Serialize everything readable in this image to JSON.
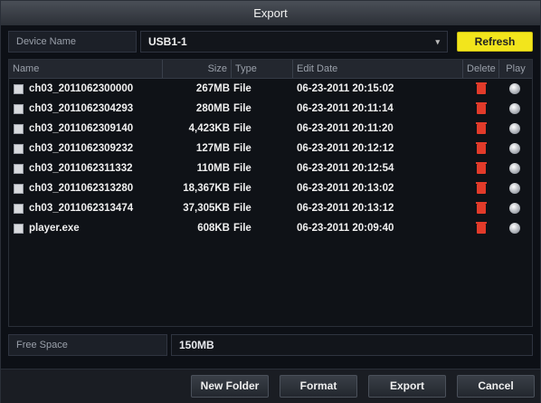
{
  "window": {
    "title": "Export"
  },
  "device": {
    "label": "Device Name",
    "selected": "USB1-1",
    "refresh_label": "Refresh"
  },
  "table": {
    "headers": {
      "name": "Name",
      "size": "Size",
      "type": "Type",
      "date": "Edit Date",
      "delete": "Delete",
      "play": "Play"
    },
    "rows": [
      {
        "name": "ch03_2011062300000",
        "size": "267MB",
        "type": "File",
        "date": "06-23-2011 20:15:02"
      },
      {
        "name": "ch03_2011062304293",
        "size": "280MB",
        "type": "File",
        "date": "06-23-2011 20:11:14"
      },
      {
        "name": "ch03_2011062309140",
        "size": "4,423KB",
        "type": "File",
        "date": "06-23-2011 20:11:20"
      },
      {
        "name": "ch03_2011062309232",
        "size": "127MB",
        "type": "File",
        "date": "06-23-2011 20:12:12"
      },
      {
        "name": "ch03_2011062311332",
        "size": "110MB",
        "type": "File",
        "date": "06-23-2011 20:12:54"
      },
      {
        "name": "ch03_2011062313280",
        "size": "18,367KB",
        "type": "File",
        "date": "06-23-2011 20:13:02"
      },
      {
        "name": "ch03_2011062313474",
        "size": "37,305KB",
        "type": "File",
        "date": "06-23-2011 20:13:12"
      },
      {
        "name": "player.exe",
        "size": "608KB",
        "type": "File",
        "date": "06-23-2011 20:09:40"
      }
    ]
  },
  "free_space": {
    "label": "Free Space",
    "value": "150MB"
  },
  "buttons": {
    "new_folder": "New Folder",
    "format": "Format",
    "export": "Export",
    "cancel": "Cancel"
  },
  "colors": {
    "refresh": "#f2e51c",
    "delete_icon": "#e23b2a"
  },
  "icons": {
    "file": "file-icon",
    "delete": "trash-icon",
    "play": "play-icon",
    "dropdown": "chevron-down-icon"
  }
}
